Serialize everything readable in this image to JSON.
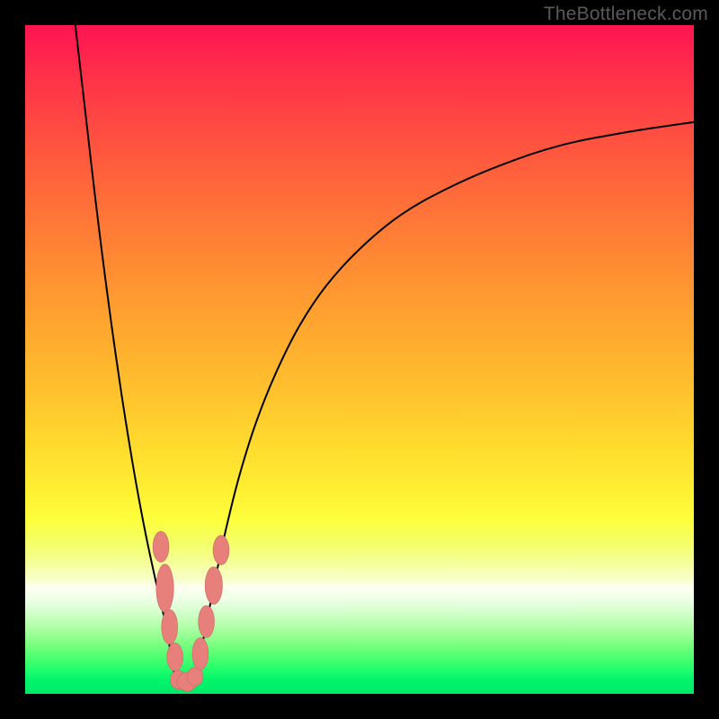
{
  "watermark": "TheBottleneck.com",
  "colors": {
    "frame": "#000000",
    "curve": "#000000",
    "marker_fill": "#e77f7b",
    "marker_stroke": "#c96a66"
  },
  "chart_data": {
    "type": "line",
    "title": "",
    "xlabel": "",
    "ylabel": "",
    "xlim": [
      0,
      100
    ],
    "ylim": [
      0,
      100
    ],
    "grid": false,
    "axes_visible": false,
    "note": "x-axis and y-axis have no tick labels; values are approximate positions in 0–100 space read from pixel geometry. y increases upward (0 at bottom of plot area).",
    "series": [
      {
        "name": "left-curve",
        "type": "line",
        "color": "#000000",
        "x": [
          7.5,
          9.0,
          10.5,
          12.0,
          13.5,
          15.0,
          16.5,
          18.0,
          19.5,
          21.0,
          21.7,
          22.3
        ],
        "y": [
          100.0,
          87.0,
          74.0,
          62.0,
          51.0,
          41.0,
          32.0,
          24.0,
          17.0,
          10.5,
          6.5,
          3.0
        ]
      },
      {
        "name": "right-curve",
        "type": "line",
        "color": "#000000",
        "x": [
          25.5,
          26.3,
          27.3,
          28.5,
          30.0,
          32.0,
          34.5,
          37.5,
          41.0,
          45.0,
          50.0,
          56.0,
          63.0,
          71.0,
          80.0,
          90.0,
          100.0
        ],
        "y": [
          3.0,
          6.5,
          11.5,
          17.5,
          24.5,
          32.5,
          40.5,
          48.0,
          55.0,
          61.0,
          66.5,
          71.5,
          75.5,
          79.0,
          82.0,
          84.0,
          85.5
        ]
      },
      {
        "name": "valley-floor",
        "type": "line",
        "color": "#000000",
        "x": [
          22.3,
          23.0,
          23.9,
          24.7,
          25.5
        ],
        "y": [
          3.0,
          2.2,
          2.0,
          2.2,
          3.0
        ]
      }
    ],
    "markers": {
      "note": "Pink oval/circle markers overlaid on the curves near the valley.",
      "fill": "#e77f7b",
      "points": [
        {
          "x": 20.3,
          "y": 22.0,
          "rx": 1.2,
          "ry": 2.3
        },
        {
          "x": 20.9,
          "y": 15.8,
          "rx": 1.3,
          "ry": 3.6
        },
        {
          "x": 21.6,
          "y": 10.0,
          "rx": 1.2,
          "ry": 2.6
        },
        {
          "x": 22.4,
          "y": 5.5,
          "rx": 1.2,
          "ry": 2.1
        },
        {
          "x": 22.9,
          "y": 2.1,
          "rx": 1.2,
          "ry": 1.4
        },
        {
          "x": 24.2,
          "y": 1.8,
          "rx": 1.5,
          "ry": 1.4
        },
        {
          "x": 25.4,
          "y": 2.6,
          "rx": 1.2,
          "ry": 1.4
        },
        {
          "x": 26.2,
          "y": 6.0,
          "rx": 1.2,
          "ry": 2.4
        },
        {
          "x": 27.1,
          "y": 10.8,
          "rx": 1.2,
          "ry": 2.4
        },
        {
          "x": 28.2,
          "y": 16.2,
          "rx": 1.3,
          "ry": 2.8
        },
        {
          "x": 29.3,
          "y": 21.5,
          "rx": 1.2,
          "ry": 2.2
        }
      ]
    }
  }
}
